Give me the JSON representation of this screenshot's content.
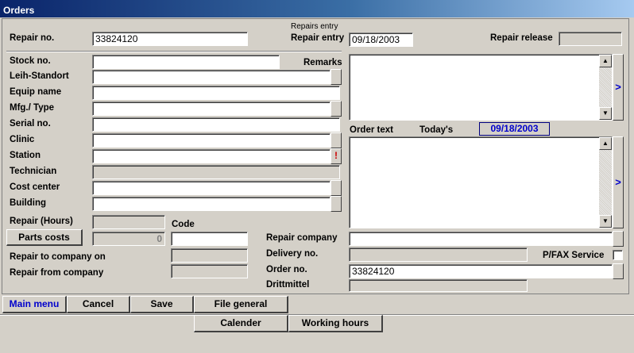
{
  "window": {
    "title": "Orders"
  },
  "header": {
    "repair_no_label": "Repair no.",
    "repair_no_value": "33824120",
    "repairs_entry_caption": "Repairs entry",
    "repair_entry_label": "Repair entry",
    "repair_entry_value": "09/18/2003",
    "repair_release_label": "Repair release",
    "repair_release_value": ""
  },
  "left": {
    "stock_no_label": "Stock no.",
    "stock_no_value": "",
    "leih_label": "Leih-Standort",
    "leih_value": "",
    "equip_label": "Equip name",
    "equip_value": "",
    "mfg_label": "Mfg./ Type",
    "mfg_value": "",
    "serial_label": "Serial no.",
    "serial_value": "",
    "clinic_label": "Clinic",
    "clinic_value": "",
    "station_label": "Station",
    "station_value": "",
    "station_alert": "!",
    "technician_label": "Technician",
    "technician_value": "",
    "cost_center_label": "Cost center",
    "cost_center_value": "",
    "building_label": "Building",
    "building_value": "",
    "repair_hours_label": "Repair (Hours)",
    "repair_hours_value": "",
    "code_label": "Code",
    "code_value": "",
    "parts_costs_label": "Parts costs",
    "parts_costs_value": "0",
    "repair_to_label": "Repair to company on",
    "repair_to_value": "",
    "repair_from_label": "Repair from company",
    "repair_from_value": ""
  },
  "right": {
    "remarks_label": "Remarks",
    "remarks_value": "",
    "order_text_label": "Order text",
    "todays_label": "Today's",
    "todays_value": "09/18/2003",
    "order_text_value": "",
    "repair_company_label": "Repair company",
    "repair_company_value": "",
    "delivery_label": "Delivery no.",
    "delivery_value": "",
    "pfax_label": "P/FAX Service",
    "order_no_label": "Order no.",
    "order_no_value": "33824120",
    "drittmittel_label": "Drittmittel",
    "drittmittel_value": "",
    "side_arrow": ">"
  },
  "toolbar": {
    "main_menu": "Main menu",
    "cancel": "Cancel",
    "save": "Save",
    "file_general": "File general",
    "calender": "Calender",
    "working_hours": "Working hours"
  },
  "colors": {
    "title_start": "#0a246a",
    "title_end": "#a6caf0",
    "accent": "#0000cc",
    "alert": "#cc0000",
    "face": "#d4d0c8"
  }
}
